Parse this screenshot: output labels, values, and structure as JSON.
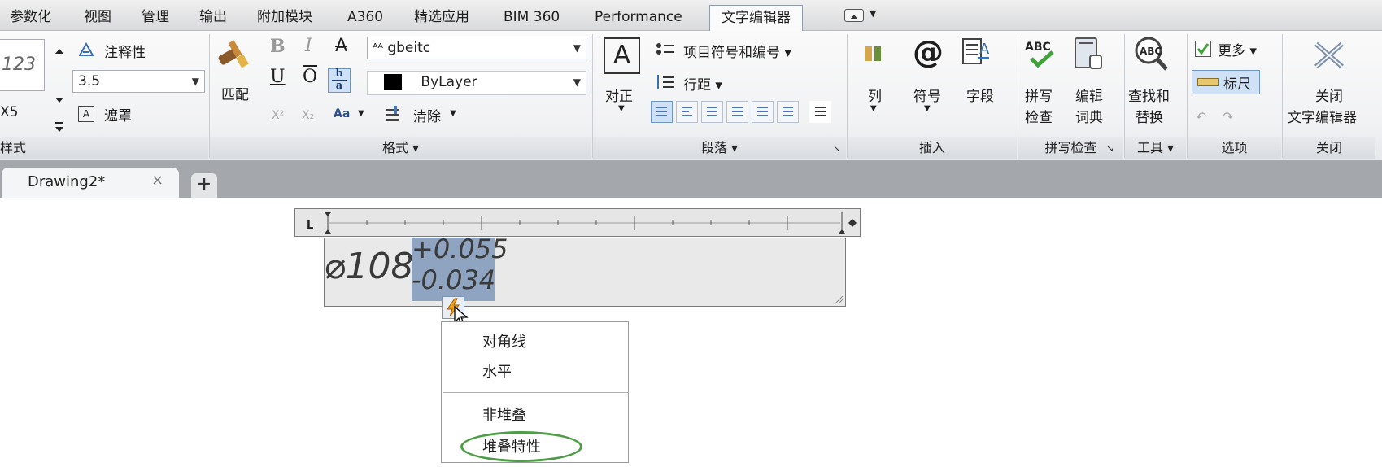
{
  "menu_tabs": [
    "参数化",
    "视图",
    "管理",
    "输出",
    "附加模块",
    "A360",
    "精选应用",
    "BIM 360",
    "Performance",
    "文字编辑器"
  ],
  "active_tab": "文字编辑器",
  "style_panel": {
    "preview_text": "123",
    "annotative_label": "注释性",
    "height_value": "3.5",
    "style_name": "X5",
    "mask_label": "遮罩",
    "title": "样式"
  },
  "format_panel": {
    "match_label": "匹配",
    "bold": "B",
    "italic": "I",
    "strike": "A",
    "font_value": "gbeitc",
    "underline": "U",
    "overline": "O",
    "stack_glyph_top": "b",
    "stack_glyph_bottom": "a",
    "color_value": "ByLayer",
    "superscript": "X²",
    "subscript": "X₂",
    "case_label": "Aa",
    "clear_label": "清除",
    "title": "格式 ▾"
  },
  "paragraph_panel": {
    "justify_label": "对正",
    "bullets_label": "项目符号和编号 ▾",
    "line_spacing_label": "行距 ▾",
    "title": "段落 ▾"
  },
  "insert_panel": {
    "columns_label": "列",
    "symbol_label": "符号",
    "field_label": "字段",
    "title": "插入"
  },
  "spell_panel": {
    "spell_check_line1": "拼写",
    "spell_check_line2": "检查",
    "edit_dict_line1": "编辑",
    "edit_dict_line2": "词典",
    "title": "拼写检查"
  },
  "tools_panel": {
    "find_replace_line1": "查找和",
    "find_replace_line2": "替换",
    "title": "工具 ▾"
  },
  "options_panel": {
    "more_label": "更多 ▾",
    "ruler_label": "标尺",
    "title": "选项"
  },
  "close_panel": {
    "close_line1": "关闭",
    "close_line2": "文字编辑器",
    "title": "关闭"
  },
  "doc_tab": {
    "name": "Drawing2*",
    "close": "×",
    "add": "+"
  },
  "editor": {
    "diameter_text": "⌀108",
    "upper_tolerance": "+0.055",
    "lower_tolerance": "-0.034"
  },
  "context_menu": {
    "items": [
      "对角线",
      "水平",
      "非堆叠",
      "堆叠特性"
    ],
    "highlighted_item": "堆叠特性"
  },
  "colors": {
    "accent": "#4c9d45",
    "selection": "#8fa4c0"
  }
}
